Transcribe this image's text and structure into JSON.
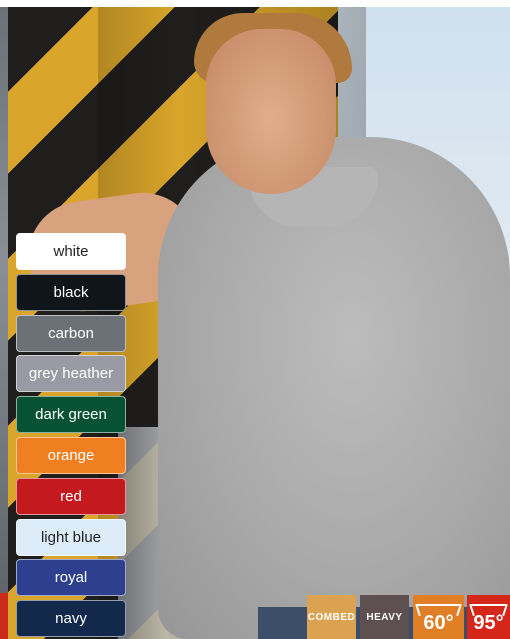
{
  "swatches": [
    {
      "label": "white",
      "bg": "#ffffff",
      "fg": "#222222"
    },
    {
      "label": "black",
      "bg": "#0f1518",
      "fg": "#ffffff"
    },
    {
      "label": "carbon",
      "bg": "#6b7177",
      "fg": "#ffffff"
    },
    {
      "label": "grey heather",
      "bg": "#9a9aa4",
      "fg": "#ffffff"
    },
    {
      "label": "dark green",
      "bg": "#075234",
      "fg": "#ffffff"
    },
    {
      "label": "orange",
      "bg": "#ef7f21",
      "fg": "#ffffff"
    },
    {
      "label": "red",
      "bg": "#c3191f",
      "fg": "#ffffff"
    },
    {
      "label": "light blue",
      "bg": "#dcecf8",
      "fg": "#222222"
    },
    {
      "label": "royal",
      "bg": "#2e3f8f",
      "fg": "#ffffff"
    },
    {
      "label": "navy",
      "bg": "#13294b",
      "fg": "#ffffff"
    }
  ],
  "badges": {
    "combed": {
      "label": "COMBED",
      "bg": "#dba351"
    },
    "heavy": {
      "label": "HEAVY",
      "bg": "#5e5050"
    },
    "wash60": {
      "label": "60°",
      "bg": "#e07f25"
    },
    "wash95": {
      "label": "95°",
      "bg": "#d42619"
    }
  }
}
